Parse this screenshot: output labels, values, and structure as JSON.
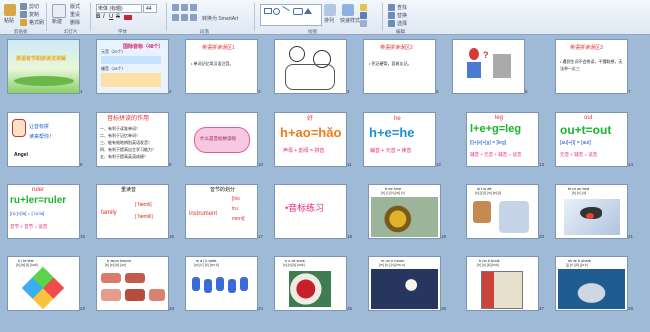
{
  "ribbon": {
    "clipboard": {
      "paste": "粘贴",
      "cut": "剪切",
      "copy": "复制",
      "format_painter": "格式刷",
      "label": "剪贴板"
    },
    "slides": {
      "new_slide": "新建",
      "layout": "版式",
      "reset": "重设",
      "delete": "删除",
      "label": "幻灯片"
    },
    "font": {
      "name": "宋体 (标题)",
      "size": "44",
      "label": "字体"
    },
    "paragraph": {
      "smartart": "转换为 SmartArt",
      "label": "段落"
    },
    "drawing": {
      "arrange": "排列",
      "quick_styles": "快速样式",
      "label": "绘图"
    },
    "editing": {
      "find": "查找",
      "replace": "替换",
      "select": "选择",
      "label": "编辑"
    }
  },
  "slides": [
    {
      "num": "1",
      "title": "英语音节和拼读法讲解"
    },
    {
      "num": "2",
      "lines": [
        "元音（20个）",
        "国际音标（48个）",
        "辅音（28个）"
      ]
    },
    {
      "num": "3",
      "title": "英语拼读误区1",
      "body": "• 单词记忆用汉语注音。"
    },
    {
      "num": "4"
    },
    {
      "num": "5",
      "title": "英语拼读误区2",
      "body": "• 死记硬背，容易忘记。"
    },
    {
      "num": "6"
    },
    {
      "num": "7",
      "title": "英语拼读误区3",
      "body": "• 遇到生词不会拼读，不懂联想，无法举一反三"
    },
    {
      "num": "8",
      "text1": "让音标拼",
      "text2": "读来帮你！",
      "name": "Angel"
    },
    {
      "num": "9",
      "title": "音标拼读的作用",
      "lines": [
        "一、有利于读准单词！",
        "二、有利于记忆单词！",
        "三、能有效地辨别英语发音！",
        "四、有利于提高自主学习能力！",
        "五、有利于提高英语成绩！"
      ]
    },
    {
      "num": "10",
      "text": "什么是音标拼读呢"
    },
    {
      "num": "11",
      "top": "好",
      "formula": "h+ao=hǎo",
      "sub": "声母 + 韵母 = 拼音"
    },
    {
      "num": "12",
      "top": "he",
      "formula": "h+e=he",
      "sub": "辅音 + 元音 = 读音"
    },
    {
      "num": "13",
      "top": "leg",
      "formula": "l+e+g=leg",
      "mid": "[l]+[e]+[g] = [leg]",
      "sub": "辅音 + 元音 + 辅音 = 读音"
    },
    {
      "num": "14",
      "top": "out",
      "formula": "ou+t=out",
      "mid": "[au]+[t] = [aut]",
      "sub": "元音 + 辅音 = 读音"
    },
    {
      "num": "15",
      "top": "ruler",
      "formula": "ru+ler=ruler",
      "mid": "[ru:]+[lə] = [ˈru:lə]",
      "sub": "音节 + 音节 = 读音"
    },
    {
      "num": "16",
      "title": "重读音",
      "word": "family",
      "ipa1": "[ˈfæmli]",
      "ipa2": "[ˈfæmili]"
    },
    {
      "num": "17",
      "title": "音节的划分",
      "word": "instrument",
      "ipa": [
        "[ins",
        "tru",
        "ment]"
      ]
    },
    {
      "num": "18",
      "text": "•音标练习"
    },
    {
      "num": "19",
      "word": "b ee hive",
      "ipa": "[b] [iː] [h] [ai] [v]"
    },
    {
      "num": "20",
      "word": "si t w ait",
      "ipa": "[s] [i] [t] [w] [ei] [t]"
    },
    {
      "num": "21",
      "word": "bi rd on bird",
      "ipa": "[b] [ɜː] [d]"
    },
    {
      "num": "22",
      "word": "k i te kite",
      "ipa": "[k] [ai] [t] [kait]"
    },
    {
      "num": "23",
      "word": "b acon bacon",
      "ipa": "[b] [ei] [k] [ən]"
    },
    {
      "num": "24",
      "word": "w a l k walk",
      "ipa": "[w] [ɔː] [k] [wɔːk]"
    },
    {
      "num": "25",
      "word": "s o ck sock",
      "ipa": "[s] [ɒ] [k] [sɒk]"
    },
    {
      "num": "26",
      "word": "m oo n moon",
      "ipa": "[m] [uː] [n] [muːn]"
    },
    {
      "num": "27",
      "word": "b oo k book",
      "ipa": "[b] [u] [k] [buk]"
    },
    {
      "num": "28",
      "word": "sh ar k shark",
      "ipa": "[ʃ] [ɑː] [k] [ʃɑːk]"
    }
  ]
}
